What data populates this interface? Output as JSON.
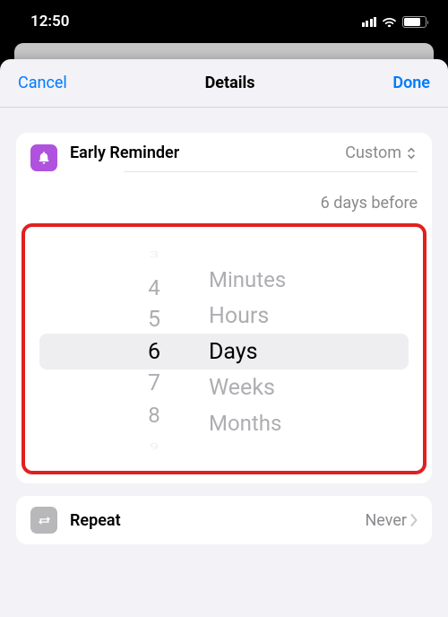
{
  "status_bar": {
    "time": "12:50"
  },
  "nav": {
    "cancel": "Cancel",
    "title": "Details",
    "done": "Done"
  },
  "early_reminder": {
    "label": "Early Reminder",
    "value_label": "Custom",
    "summary": "6 days before"
  },
  "picker": {
    "numbers": {
      "n0": "3",
      "n1": "4",
      "n2": "5",
      "n3": "6",
      "n4": "7",
      "n5": "8",
      "n6": "9"
    },
    "units": {
      "u0": "Minutes",
      "u1": "Hours",
      "u2": "Days",
      "u3": "Weeks",
      "u4": "Months"
    }
  },
  "repeat": {
    "label": "Repeat",
    "value": "Never"
  }
}
